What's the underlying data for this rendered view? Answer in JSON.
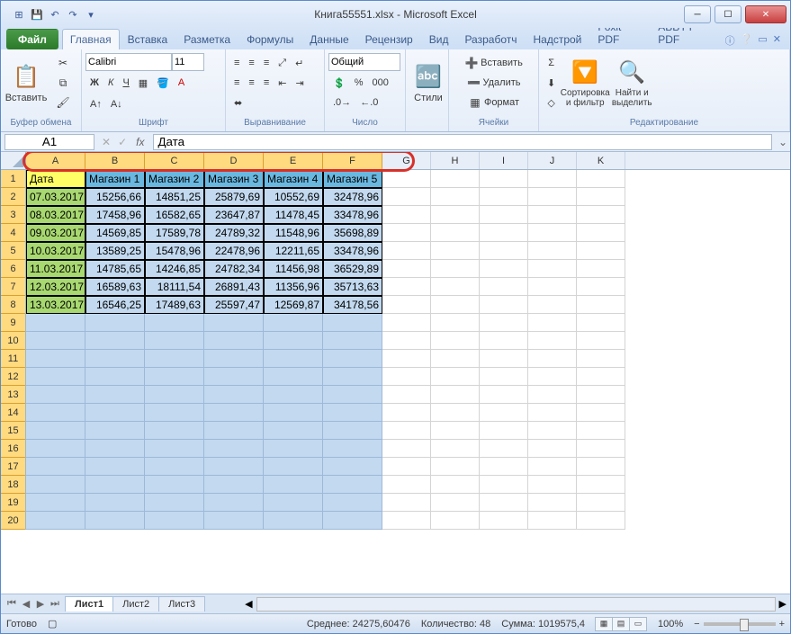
{
  "title": "Книга55551.xlsx - Microsoft Excel",
  "tabs": {
    "file": "Файл",
    "list": [
      "Главная",
      "Вставка",
      "Разметка",
      "Формулы",
      "Данные",
      "Рецензир",
      "Вид",
      "Разработч",
      "Надстрой",
      "Foxit PDF",
      "ABBYY PDF"
    ],
    "active": 0
  },
  "ribbon": {
    "clipboard": {
      "paste": "Вставить",
      "label": "Буфер обмена"
    },
    "font": {
      "name": "Calibri",
      "size": "11",
      "label": "Шрифт"
    },
    "align": {
      "label": "Выравнивание"
    },
    "number": {
      "format": "Общий",
      "label": "Число"
    },
    "styles": {
      "btn": "Стили"
    },
    "cells": {
      "insert": "Вставить",
      "delete": "Удалить",
      "format": "Формат",
      "label": "Ячейки"
    },
    "editing": {
      "sort": "Сортировка и фильтр",
      "find": "Найти и выделить",
      "label": "Редактирование"
    }
  },
  "namebox": "A1",
  "formula": "Дата",
  "columns": [
    "A",
    "B",
    "C",
    "D",
    "E",
    "F",
    "G",
    "H",
    "I",
    "J",
    "K"
  ],
  "selectedCols": [
    "A",
    "B",
    "C",
    "D",
    "E",
    "F"
  ],
  "rowCount": 20,
  "selectedRows": 20,
  "chart_data": {
    "type": "table",
    "headers": [
      "Дата",
      "Магазин 1",
      "Магазин 2",
      "Магазин 3",
      "Магазин 4",
      "Магазин 5"
    ],
    "rows": [
      [
        "07.03.2017",
        "15256,66",
        "14851,25",
        "25879,69",
        "10552,69",
        "32478,96"
      ],
      [
        "08.03.2017",
        "17458,96",
        "16582,65",
        "23647,87",
        "11478,45",
        "33478,96"
      ],
      [
        "09.03.2017",
        "14569,85",
        "17589,78",
        "24789,32",
        "11548,96",
        "35698,89"
      ],
      [
        "10.03.2017",
        "13589,25",
        "15478,96",
        "22478,96",
        "12211,65",
        "33478,96"
      ],
      [
        "11.03.2017",
        "14785,65",
        "14246,85",
        "24782,34",
        "11456,98",
        "36529,89"
      ],
      [
        "12.03.2017",
        "16589,63",
        "18111,54",
        "26891,43",
        "11356,96",
        "35713,63"
      ],
      [
        "13.03.2017",
        "16546,25",
        "17489,63",
        "25597,47",
        "12569,87",
        "34178,56"
      ]
    ]
  },
  "sheets": {
    "list": [
      "Лист1",
      "Лист2",
      "Лист3"
    ],
    "active": 0
  },
  "status": {
    "ready": "Готово",
    "avg_label": "Среднее:",
    "avg": "24275,60476",
    "count_label": "Количество:",
    "count": "48",
    "sum_label": "Сумма:",
    "sum": "1019575,4",
    "zoom": "100%"
  },
  "colWidths": {
    "data": 66,
    "other": 54
  }
}
